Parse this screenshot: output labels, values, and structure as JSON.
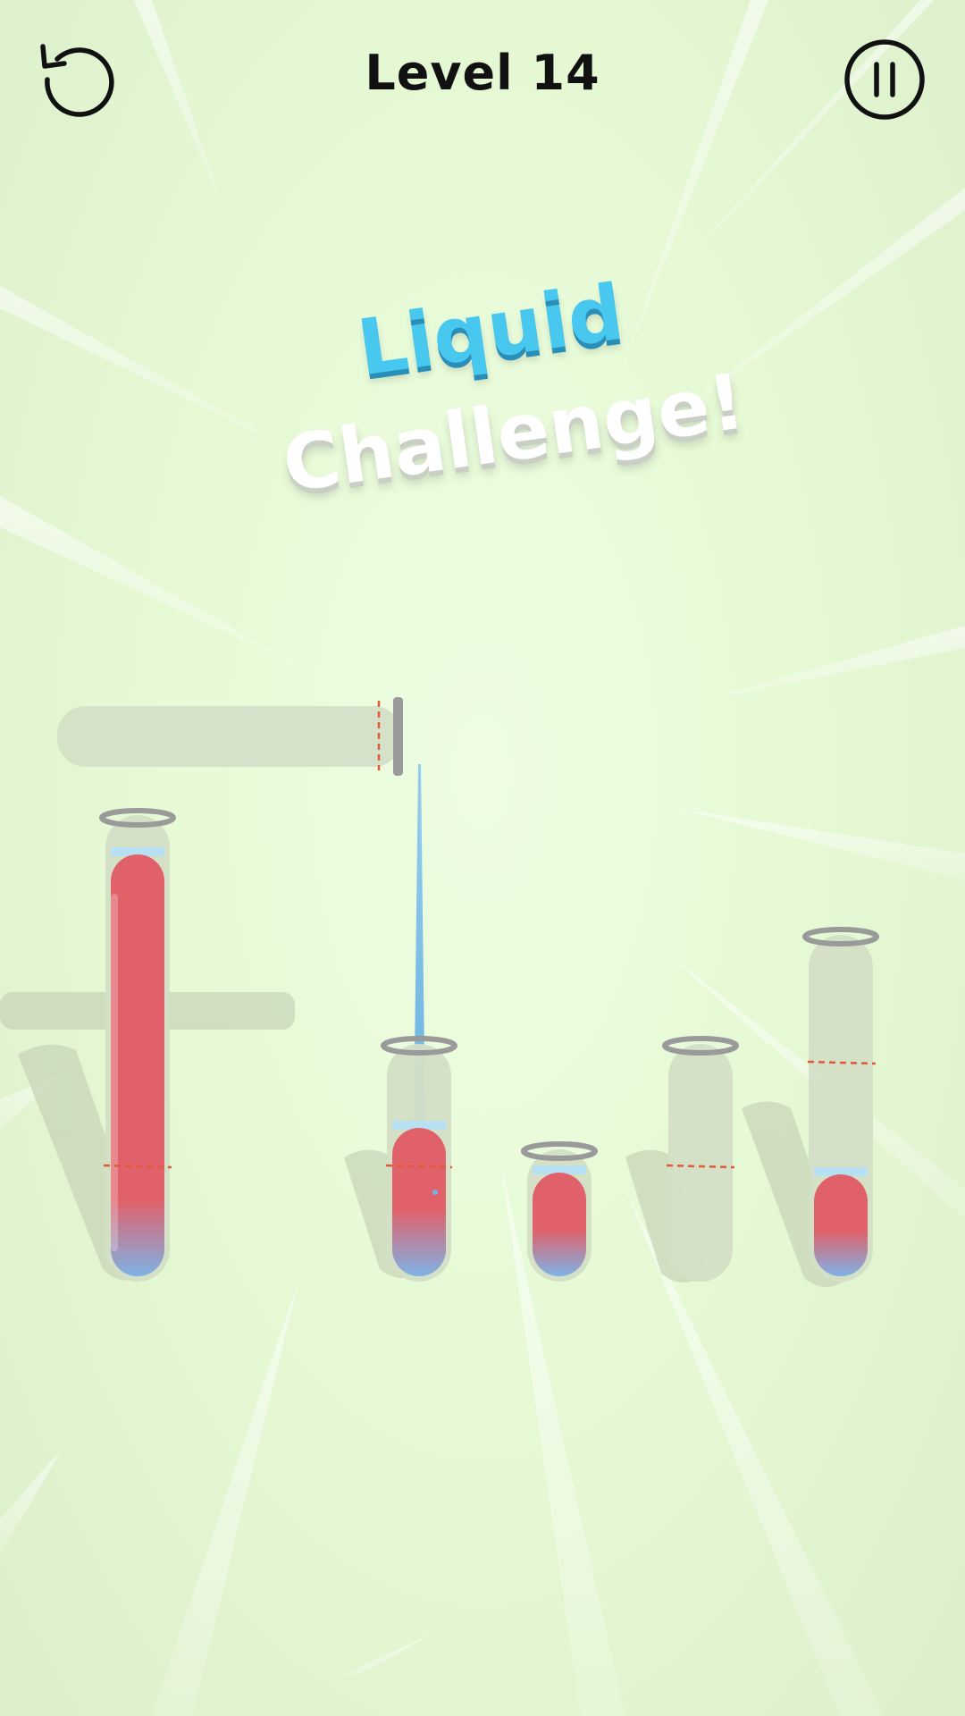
{
  "header": {
    "level_label": "Level",
    "level_number": "14",
    "restart_icon": "restart-icon",
    "pause_icon": "pause-icon"
  },
  "banner": {
    "line1": "Liquid",
    "line2": "Challenge!"
  },
  "colors": {
    "liquid_red": "#e0616a",
    "liquid_blue": "#6fb3e8",
    "glass": "#d3dfc6",
    "rim": "#9a9a9a",
    "target_line": "#e05a3a",
    "banner_blue": "#49c8ef"
  },
  "tubes": [
    {
      "id": "source-tube",
      "state": "tilted-pouring",
      "fill": 0
    },
    {
      "id": "tube-1",
      "fill": 0.93,
      "target_fill": 0.25
    },
    {
      "id": "tube-2",
      "fill": 0.62,
      "target_fill": 0.47
    },
    {
      "id": "tube-3",
      "fill": 0.78
    },
    {
      "id": "tube-4",
      "fill": 0,
      "target_fill": 0.47
    },
    {
      "id": "tube-5",
      "fill": 0.33,
      "target_fill": 0.65
    }
  ]
}
